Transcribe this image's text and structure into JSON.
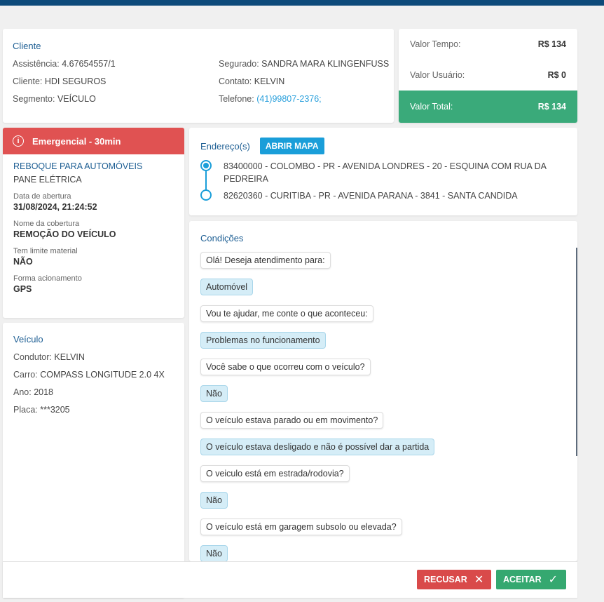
{
  "client": {
    "title": "Cliente",
    "assistencia_label": "Assistência:",
    "assistencia": "4.67654557/1",
    "cliente_label": "Cliente:",
    "cliente": "HDI SEGUROS",
    "segmento_label": "Segmento:",
    "segmento": "VEÍCULO",
    "segurado_label": "Segurado:",
    "segurado": "SANDRA MARA KLINGENFUSS",
    "contato_label": "Contato:",
    "contato": "KELVIN",
    "telefone_label": "Telefone:",
    "telefone": "(41)99807-2376;"
  },
  "values": {
    "tempo_label": "Valor Tempo:",
    "tempo": "R$ 134",
    "usuario_label": "Valor Usuário:",
    "usuario": "R$ 0",
    "total_label": "Valor Total:",
    "total": "R$ 134",
    "total_color": "#3aaa7a"
  },
  "service": {
    "badge": "Emergencial - 30min",
    "badge_color": "#e05252",
    "badge_icon": "info-icon",
    "type": "REBOQUE PARA AUTOMÓVEIS",
    "subtype": "PANE ELÉTRICA",
    "fields": [
      {
        "label": "Data de abertura",
        "value": "31/08/2024, 21:24:52"
      },
      {
        "label": "Nome da cobertura",
        "value": "REMOÇÃO DO VEÍCULO"
      },
      {
        "label": "Tem limite material",
        "value": "NÃO"
      },
      {
        "label": "Forma acionamento",
        "value": "GPS"
      }
    ]
  },
  "vehicle": {
    "title": "Veículo",
    "condutor_label": "Condutor:",
    "condutor": "KELVIN",
    "carro_label": "Carro:",
    "carro": "COMPASS LONGITUDE 2.0 4X",
    "ano_label": "Ano:",
    "ano": "2018",
    "placa_label": "Placa:",
    "placa": "***3205"
  },
  "address": {
    "title": "Endereço(s)",
    "map_button": "ABRIR MAPA",
    "items": [
      "83400000 - COLOMBO - PR - AVENIDA LONDRES - 20 - ESQUINA COM RUA DA PEDREIRA",
      "82620360 - CURITIBA - PR - AVENIDA PARANA - 3841 - SANTA CANDIDA"
    ]
  },
  "conditions": {
    "title": "Condições",
    "messages": [
      {
        "type": "q",
        "text": "Olá! Deseja atendimento para:"
      },
      {
        "type": "a",
        "text": "Automóvel"
      },
      {
        "type": "q",
        "text": "Vou te ajudar, me conte o que aconteceu:"
      },
      {
        "type": "a",
        "text": "Problemas no funcionamento"
      },
      {
        "type": "q",
        "text": "Você sabe o que ocorreu com o veículo?"
      },
      {
        "type": "a",
        "text": "Não"
      },
      {
        "type": "q",
        "text": "O veículo estava parado ou em movimento?"
      },
      {
        "type": "a",
        "text": "O veículo estava desligado e não é possível dar a partida"
      },
      {
        "type": "q",
        "text": "O veiculo está em estrada/rodovia?"
      },
      {
        "type": "a",
        "text": "Não"
      },
      {
        "type": "q",
        "text": "O veículo está em garagem subsolo ou elevada?"
      },
      {
        "type": "a",
        "text": "Não"
      }
    ]
  },
  "footer": {
    "reject_label": "RECUSAR",
    "reject_icon": "close-icon",
    "accept_label": "ACEITAR",
    "accept_icon": "check-icon"
  }
}
